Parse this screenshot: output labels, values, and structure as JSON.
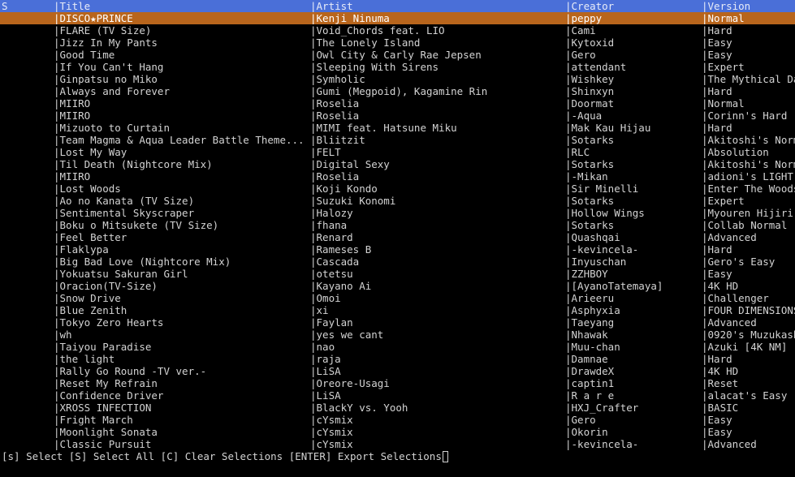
{
  "columns": {
    "s": "S",
    "title": "|Title",
    "artist": "|Artist",
    "creator": "|Creator",
    "version": "|Version"
  },
  "selected_index": 0,
  "rows": [
    {
      "s": "",
      "title": "|DISCO★PRINCE",
      "artist": "|Kenji Ninuma",
      "creator": "|peppy",
      "version": "|Normal"
    },
    {
      "s": "",
      "title": "|FLARE (TV Size)",
      "artist": "|Void_Chords feat. LIO",
      "creator": "|Cami",
      "version": "|Hard"
    },
    {
      "s": "",
      "title": "|Jizz In My Pants",
      "artist": "|The Lonely Island",
      "creator": "|Kytoxid",
      "version": "|Easy"
    },
    {
      "s": "",
      "title": "|Good Time",
      "artist": "|Owl City & Carly Rae Jepsen",
      "creator": "|Gero",
      "version": "|Easy"
    },
    {
      "s": "",
      "title": "|If You Can't Hang",
      "artist": "|Sleeping With Sirens",
      "creator": "|attendant",
      "version": "|Expert"
    },
    {
      "s": "",
      "title": "|Ginpatsu no Miko",
      "artist": "|Symholic",
      "creator": "|Wishkey",
      "version": "|The Mythical Da"
    },
    {
      "s": "",
      "title": "|Always and Forever",
      "artist": "|Gumi (Megpoid), Kagamine Rin",
      "creator": "|Shinxyn",
      "version": "|Hard"
    },
    {
      "s": "",
      "title": "|MIIRO",
      "artist": "|Roselia",
      "creator": "|Doormat",
      "version": "|Normal"
    },
    {
      "s": "",
      "title": "|MIIRO",
      "artist": "|Roselia",
      "creator": "|-Aqua",
      "version": "|Corinn's Hard"
    },
    {
      "s": "",
      "title": "|Mizuoto to Curtain",
      "artist": "|MIMI feat. Hatsune Miku",
      "creator": "|Mak Kau Hijau",
      "version": "|Hard"
    },
    {
      "s": "",
      "title": "|Team Magma & Aqua Leader Battle Theme...",
      "artist": "|Bliitzit",
      "creator": "|Sotarks",
      "version": "|Akitoshi's Norm"
    },
    {
      "s": "",
      "title": "|Lost My Way",
      "artist": "|FELT",
      "creator": "|RLC",
      "version": "|Absolution"
    },
    {
      "s": "",
      "title": "|Til Death (Nightcore Mix)",
      "artist": "|Digital Sexy",
      "creator": "|Sotarks",
      "version": "|Akitoshi's Norm"
    },
    {
      "s": "",
      "title": "|MIIRO",
      "artist": "|Roselia",
      "creator": "|-Mikan",
      "version": "|adioni's LIGHT"
    },
    {
      "s": "",
      "title": "|Lost Woods",
      "artist": "|Koji Kondo",
      "creator": "|Sir Minelli",
      "version": "|Enter The Woods"
    },
    {
      "s": "",
      "title": "|Ao no Kanata (TV Size)",
      "artist": "|Suzuki Konomi",
      "creator": "|Sotarks",
      "version": "|Expert"
    },
    {
      "s": "",
      "title": "|Sentimental Skyscraper",
      "artist": "|Halozy",
      "creator": "|Hollow Wings",
      "version": "|Myouren Hijiri"
    },
    {
      "s": "",
      "title": "|Boku o Mitsukete (TV Size)",
      "artist": "|fhana",
      "creator": "|Sotarks",
      "version": "|Collab Normal"
    },
    {
      "s": "",
      "title": "|Feel Better",
      "artist": "|Renard",
      "creator": "|Quashqai",
      "version": "|Advanced"
    },
    {
      "s": "",
      "title": "|Flaklypa",
      "artist": "|Rameses B",
      "creator": "|-kevincela-",
      "version": "|Hard"
    },
    {
      "s": "",
      "title": "|Big Bad Love (Nightcore Mix)",
      "artist": "|Cascada",
      "creator": "|Inyuschan",
      "version": "|Gero's Easy"
    },
    {
      "s": "",
      "title": "|Yokuatsu Sakuran Girl",
      "artist": "|otetsu",
      "creator": "|ZZHBOY",
      "version": "|Easy"
    },
    {
      "s": "",
      "title": "|Oracion(TV-Size)",
      "artist": "|Kayano Ai",
      "creator": "|[AyanoTatemaya]",
      "version": "|4K HD"
    },
    {
      "s": "",
      "title": "|Snow Drive",
      "artist": "|Omoi",
      "creator": "|Arieeru",
      "version": "|Challenger"
    },
    {
      "s": "",
      "title": "|Blue Zenith",
      "artist": "|xi",
      "creator": "|Asphyxia",
      "version": "|FOUR DIMENSIONS"
    },
    {
      "s": "",
      "title": "|Tokyo Zero Hearts",
      "artist": "|Faylan",
      "creator": "|Taeyang",
      "version": "|Advanced"
    },
    {
      "s": "",
      "title": "|wh",
      "artist": "|yes we cant",
      "creator": "|Nhawak",
      "version": "|0920's Muzukash"
    },
    {
      "s": "",
      "title": "|Taiyou Paradise",
      "artist": "|nao",
      "creator": "|Muu-chan",
      "version": "|Azuki [4K NM]"
    },
    {
      "s": "",
      "title": "|the light",
      "artist": "|raja",
      "creator": "|Damnae",
      "version": "|Hard"
    },
    {
      "s": "",
      "title": "|Rally Go Round -TV ver.-",
      "artist": "|LiSA",
      "creator": "|DrawdeX",
      "version": "|4K HD"
    },
    {
      "s": "",
      "title": "|Reset My Refrain",
      "artist": "|Oreore-Usagi",
      "creator": "|captin1",
      "version": "|Reset"
    },
    {
      "s": "",
      "title": "|Confidence Driver",
      "artist": "|LiSA",
      "creator": "|R a r e",
      "version": "|alacat's Easy"
    },
    {
      "s": "",
      "title": "|XROSS INFECTION",
      "artist": "|BlackY vs. Yooh",
      "creator": "|HXJ_Crafter",
      "version": "|BASIC"
    },
    {
      "s": "",
      "title": "|Fright March",
      "artist": "|cYsmix",
      "creator": "|Gero",
      "version": "|Easy"
    },
    {
      "s": "",
      "title": "|Moonlight Sonata",
      "artist": "|cYsmix",
      "creator": "|Okorin",
      "version": "|Easy"
    },
    {
      "s": "",
      "title": "|Classic Pursuit",
      "artist": "|cYsmix",
      "creator": "|-kevincela-",
      "version": "|Advanced"
    }
  ],
  "footer": {
    "help": "[s] Select [S] Select All [C] Clear Selections [ENTER] Export Selections"
  },
  "colors": {
    "background": "#000000",
    "text": "#d3d3d3",
    "header_bg": "#4a6fd8",
    "selected_bg": "#b8651c"
  }
}
